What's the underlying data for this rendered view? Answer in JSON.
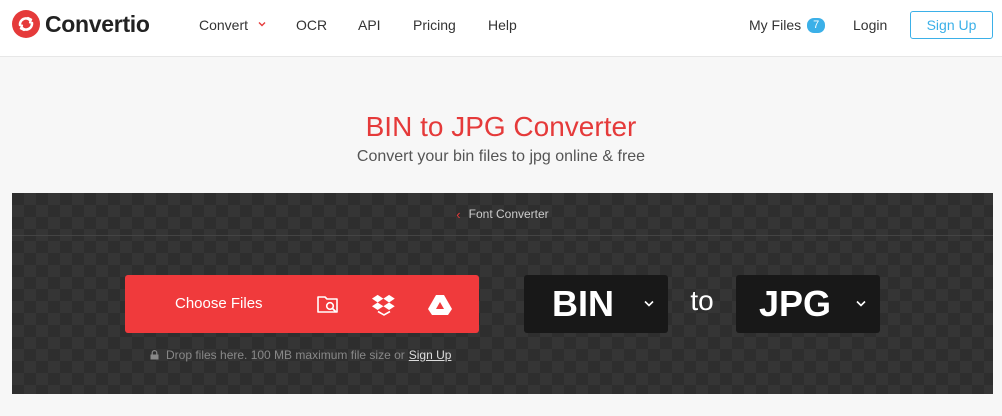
{
  "header": {
    "brand": "Convertio",
    "nav": [
      "Convert",
      "OCR",
      "API",
      "Pricing",
      "Help"
    ],
    "my_files": "My Files",
    "my_files_count": "7",
    "login": "Login",
    "signup": "Sign Up"
  },
  "hero": {
    "title": "BIN to JPG Converter",
    "subtitle": "Convert your bin files to jpg online & free"
  },
  "converter": {
    "breadcrumb": "Font Converter",
    "choose_files": "Choose Files",
    "drop_text": "Drop files here. 100 MB maximum file size or",
    "drop_link": "Sign Up",
    "from_format": "BIN",
    "to_word": "to",
    "to_format": "JPG"
  },
  "colors": {
    "brand_red": "#e53a3a",
    "accent_blue": "#3bb0e8",
    "panel_dark": "#2e2e2e"
  },
  "icons": [
    "convertio-logo-icon",
    "chevron-down-icon",
    "folder-search-icon",
    "dropbox-icon",
    "google-drive-icon",
    "lock-icon",
    "chevron-left-icon"
  ]
}
